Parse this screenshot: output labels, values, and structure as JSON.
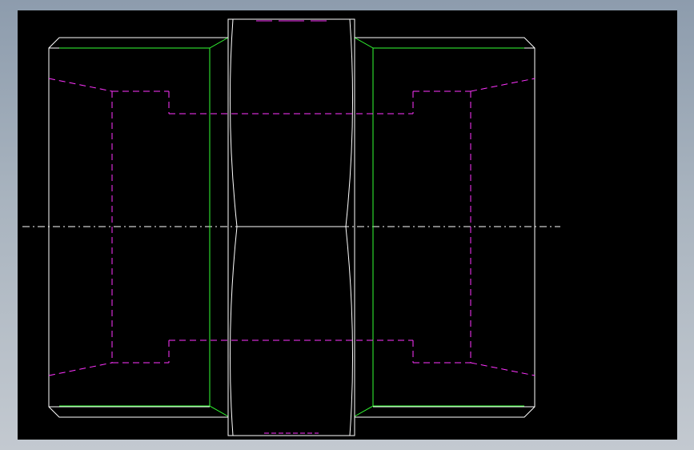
{
  "canvas": {
    "background": "#000000",
    "frame_color": "#a8b4c0"
  },
  "colors": {
    "outline": "#ffffff",
    "thread_edge": "#33ff33",
    "hidden": "#ff33ff",
    "centerline": "#ffffff"
  },
  "annotations": {
    "top_label": "",
    "bottom_label": ""
  }
}
